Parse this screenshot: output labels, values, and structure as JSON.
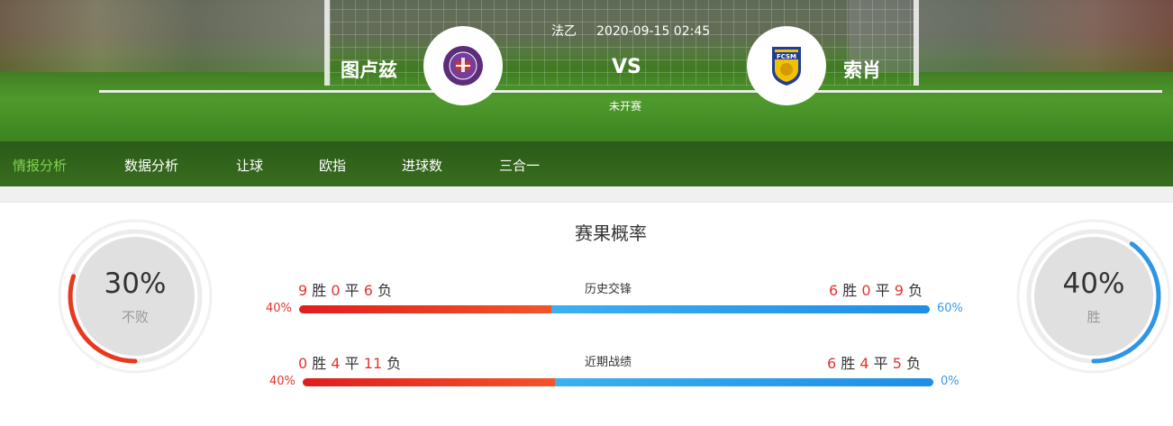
{
  "match": {
    "league": "法乙",
    "datetime": "2020-09-15 02:45",
    "home_team": "图卢兹",
    "away_team": "索肖",
    "vs": "VS",
    "status": "未开赛"
  },
  "nav": {
    "items": [
      "情报分析",
      "数据分析",
      "让球",
      "欧指",
      "进球数",
      "三合一"
    ],
    "active": "情报分析"
  },
  "probability": {
    "title": "赛果概率",
    "left": {
      "value": "30%",
      "label": "不败",
      "fraction": 0.3,
      "color": "#e8391f"
    },
    "right": {
      "value": "40%",
      "label": "胜",
      "fraction": 0.4,
      "color": "#2d96e6"
    }
  },
  "history": {
    "label": "历史交锋",
    "home": {
      "w": "9",
      "d": "0",
      "l": "6"
    },
    "away": {
      "w": "6",
      "d": "0",
      "l": "9"
    },
    "home_pct": "40%",
    "away_pct": "60%",
    "home_fraction": 0.4
  },
  "recent": {
    "label": "近期战绩",
    "home": {
      "w": "0",
      "d": "4",
      "l": "11"
    },
    "away": {
      "w": "6",
      "d": "4",
      "l": "5"
    },
    "home_pct": "40%",
    "away_pct": "0%",
    "home_fraction": 0.4
  },
  "words": {
    "win": "胜",
    "draw": "平",
    "loss": "负"
  },
  "colors": {
    "red": "#e3342f",
    "blue": "#3a9ae8",
    "nav_active": "#7fd352"
  },
  "icons": {
    "home_logo": "toulouse-crest-icon",
    "away_logo": "fcsm-lion-crest-icon"
  }
}
